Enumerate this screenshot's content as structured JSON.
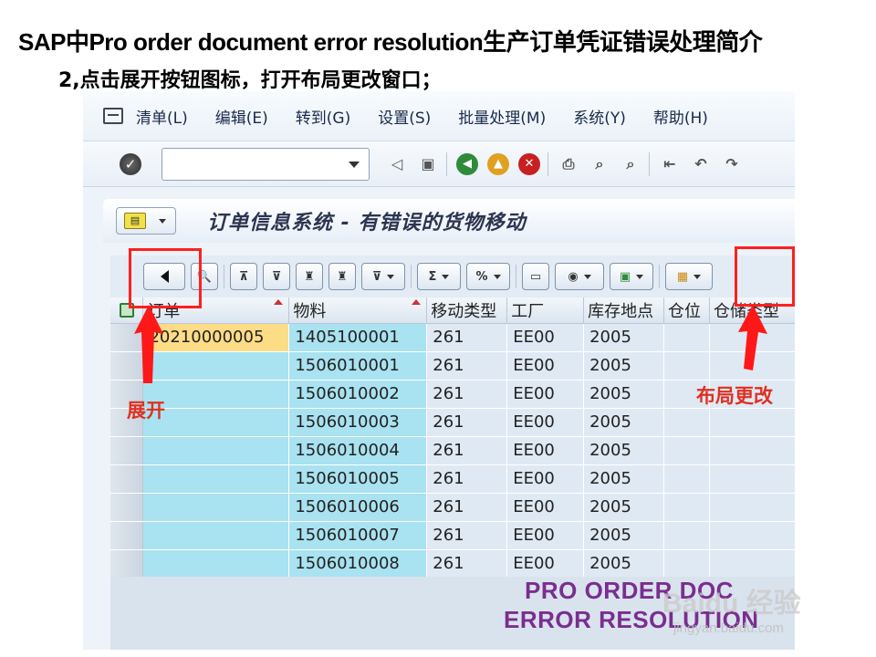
{
  "slide": {
    "title": "SAP中Pro order document error resolution生产订单凭证错误处理简介",
    "subtitle": "2,点击展开按钮图标，打开布局更改窗口；"
  },
  "menu": {
    "items": [
      "清单(L)",
      "编辑(E)",
      "转到(G)",
      "设置(S)",
      "批量处理(M)",
      "系统(Y)",
      "帮助(H)"
    ]
  },
  "toolbar": {
    "command_field_value": "",
    "icons": [
      "enter-icon",
      "back-nav-icon",
      "save-icon",
      "back-icon",
      "exit-icon",
      "cancel-icon",
      "print-icon",
      "find-icon",
      "find-next-icon",
      "first-page-icon",
      "prev-page-icon",
      "next-page-icon"
    ]
  },
  "screen": {
    "title": "订单信息系统 - 有错误的货物移动"
  },
  "alv_toolbar": {
    "icons": [
      "expand-icon",
      "details-icon",
      "sort-ascending-icon",
      "sort-descending-icon",
      "find-icon",
      "find-next-icon",
      "filter-icon",
      "sum-icon",
      "subtotal-icon",
      "print-preview-icon",
      "export-icon",
      "views-icon",
      "change-layout-icon"
    ]
  },
  "grid": {
    "columns": [
      "订单",
      "物料",
      "移动类型",
      "工厂",
      "库存地点",
      "仓位",
      "仓储类型"
    ],
    "rows": [
      [
        "20210000005",
        "1405100001",
        "261",
        "EE00",
        "2005",
        "",
        ""
      ],
      [
        "",
        "1506010001",
        "261",
        "EE00",
        "2005",
        "",
        ""
      ],
      [
        "",
        "1506010002",
        "261",
        "EE00",
        "2005",
        "",
        ""
      ],
      [
        "",
        "1506010003",
        "261",
        "EE00",
        "2005",
        "",
        ""
      ],
      [
        "",
        "1506010004",
        "261",
        "EE00",
        "2005",
        "",
        ""
      ],
      [
        "",
        "1506010005",
        "261",
        "EE00",
        "2005",
        "",
        ""
      ],
      [
        "",
        "1506010006",
        "261",
        "EE00",
        "2005",
        "",
        ""
      ],
      [
        "",
        "1506010007",
        "261",
        "EE00",
        "2005",
        "",
        ""
      ],
      [
        "",
        "1506010008",
        "261",
        "EE00",
        "2005",
        "",
        ""
      ]
    ]
  },
  "annotations": {
    "expand_label": "展开",
    "layout_label": "布局更改"
  },
  "watermark": {
    "line1": "PRO ORDER DOC",
    "line2": "ERROR RESOLUTION",
    "baidu": "Baidu 经验",
    "url": "jingyan.baidu.com"
  },
  "colors": {
    "highlight": "#ff2020",
    "key_column": "#a9e2f0",
    "selected_cell": "#fddc86",
    "watermark_text": "#7a2e8e"
  }
}
